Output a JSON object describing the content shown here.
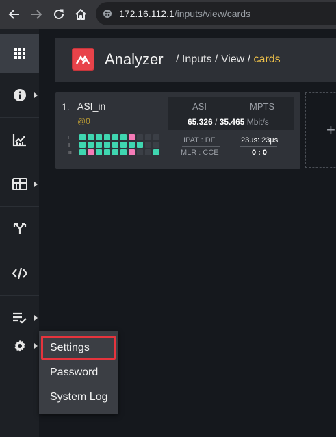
{
  "browser": {
    "url_host": "172.16.112.1",
    "url_path": "/inputs/view/cards"
  },
  "header": {
    "app_title": "Analyzer",
    "breadcrumb_prefix": "/ Inputs / View /",
    "breadcrumb_current": "cards"
  },
  "card": {
    "number": "1.",
    "name": "ASI_in",
    "id": "@0",
    "lanes": [
      "I",
      "II",
      "III"
    ],
    "col_asi": "ASI",
    "col_mpts": "MPTS",
    "asi_value": "65.326",
    "separator": "/",
    "mpts_value": "35.465",
    "rate_unit": "Mbit/s",
    "ipat_label": "IPAT : DF",
    "mlr_label": "MLR : CCE",
    "ipat_value": "23µs: 23µs",
    "mlr_value": "0 : 0"
  },
  "add_card": {
    "symbol": "+"
  },
  "menu": {
    "items": [
      "Settings",
      "Password",
      "System Log"
    ],
    "selected": "Settings"
  },
  "colors": {
    "ok": "#3fd6b0",
    "error": "#f57bb7",
    "empty": "#3b3f46",
    "accent": "#f0c24a",
    "logo": "#e8434a",
    "highlight": "#e5343d"
  },
  "grid": {
    "rows": [
      [
        "ok",
        "ok",
        "ok",
        "ok",
        "ok",
        "ok",
        "error",
        "empty",
        "empty",
        "empty"
      ],
      [
        "ok",
        "ok",
        "ok",
        "ok",
        "ok",
        "ok",
        "ok",
        "ok",
        "empty",
        "empty"
      ],
      [
        "ok",
        "error",
        "ok",
        "ok",
        "ok",
        "ok",
        "error",
        "empty",
        "empty",
        "ok"
      ]
    ]
  },
  "icons": {
    "back": "arrow-left-icon",
    "forward": "arrow-right-icon",
    "reload": "reload-icon",
    "home": "home-icon",
    "site_info": "site-info-icon",
    "sidebar": [
      "grid-icon",
      "info-icon",
      "chart-icon",
      "table-icon",
      "merge-icon",
      "code-icon",
      "checklist-icon",
      "gear-icon"
    ]
  }
}
